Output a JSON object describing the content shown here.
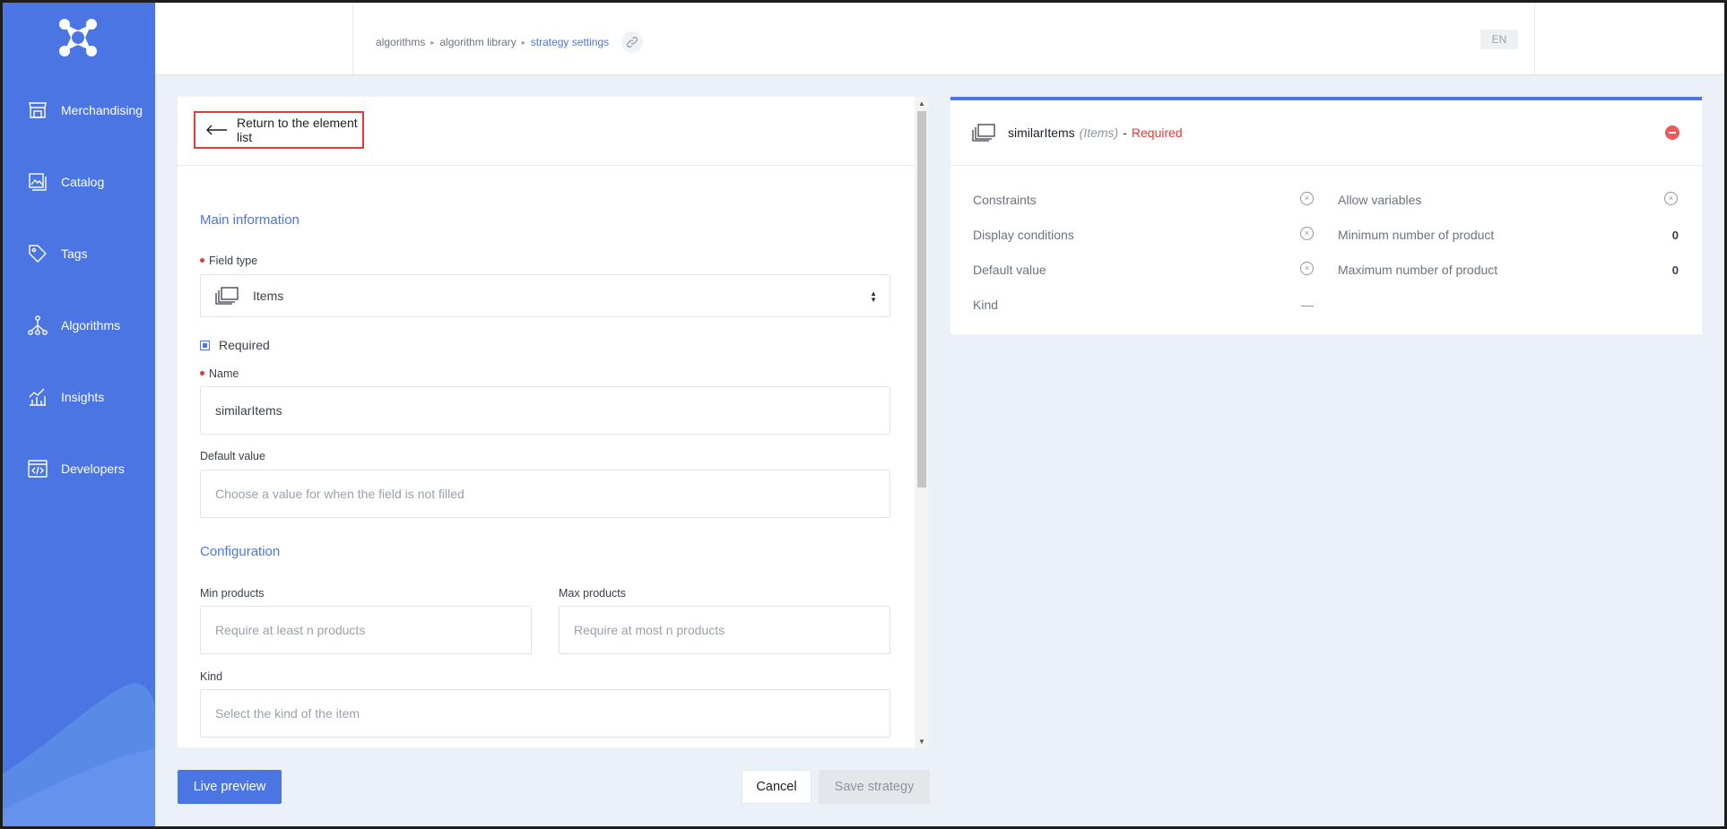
{
  "sidebar": {
    "items": [
      {
        "label": "Merchandising",
        "icon": "storefront-icon"
      },
      {
        "label": "Catalog",
        "icon": "catalog-icon"
      },
      {
        "label": "Tags",
        "icon": "tag-icon"
      },
      {
        "label": "Algorithms",
        "icon": "algorithm-tree-icon",
        "active": true
      },
      {
        "label": "Insights",
        "icon": "chart-icon"
      },
      {
        "label": "Developers",
        "icon": "code-window-icon"
      }
    ]
  },
  "topbar": {
    "breadcrumb": [
      "algorithms",
      "algorithm library",
      "strategy settings"
    ],
    "language": "EN"
  },
  "form": {
    "return_label": "Return to the element list",
    "main_info_title": "Main information",
    "field_type_label": "Field type",
    "field_type_value": "Items",
    "required_label": "Required",
    "required_checked": true,
    "name_label": "Name",
    "name_value": "similarItems",
    "default_value_label": "Default value",
    "default_value_placeholder": "Choose a value for when the field is not filled",
    "configuration_title": "Configuration",
    "min_products_label": "Min products",
    "min_products_placeholder": "Require at least n products",
    "max_products_label": "Max products",
    "max_products_placeholder": "Require at most n products",
    "kind_label": "Kind",
    "kind_placeholder": "Select the kind of the item"
  },
  "actions": {
    "live_preview": "Live preview",
    "cancel": "Cancel",
    "save": "Save strategy"
  },
  "preview": {
    "name": "similarItems",
    "type": "(Items)",
    "dash": "-",
    "required": "Required",
    "rows_left": [
      {
        "label": "Constraints",
        "value": "x"
      },
      {
        "label": "Display conditions",
        "value": "x"
      },
      {
        "label": "Default value",
        "value": "x"
      },
      {
        "label": "Kind",
        "value": "—"
      }
    ],
    "rows_right": [
      {
        "label": "Allow variables",
        "value": "x"
      },
      {
        "label": "Minimum number of product",
        "value": "0"
      },
      {
        "label": "Maximum number of product",
        "value": "0"
      }
    ]
  },
  "colors": {
    "brand": "#4b75e2",
    "danger": "#e03a3a"
  }
}
